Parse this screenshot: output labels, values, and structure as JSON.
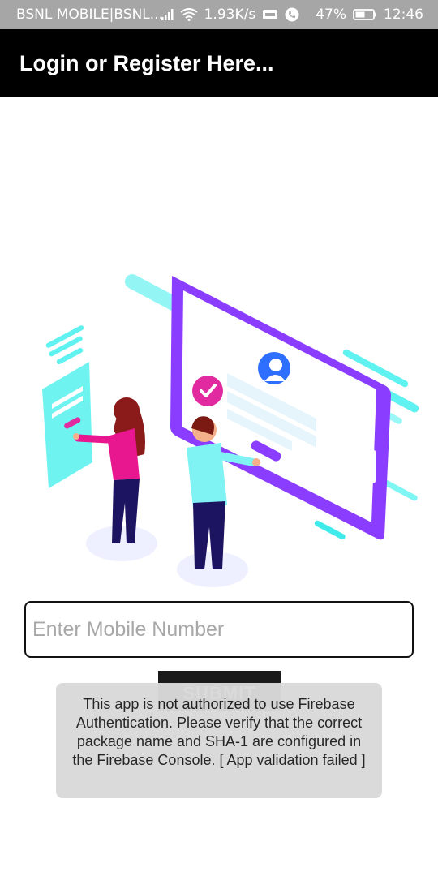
{
  "status_bar": {
    "carrier": "BSNL MOBILE|BSNL...",
    "net_speed": "1.93K/s",
    "battery": "47%",
    "time": "12:46",
    "icons": [
      "signal-icon",
      "wifi-icon",
      "volte-icon",
      "call-icon",
      "battery-icon"
    ]
  },
  "app_bar": {
    "title": "Login or Register Here..."
  },
  "form": {
    "mobile_placeholder": "Enter Mobile Number",
    "mobile_value": "",
    "submit_label": "SUBMIT"
  },
  "toast": {
    "message": "This app is not authorized to use Firebase Authentication. Please verify that the correct package name and SHA-1 are configured in the Firebase Console. [ App validation failed ]"
  },
  "colors": {
    "status_bar_bg": "#a6a6a6",
    "app_bar_bg": "#000000",
    "accent_purple": "#8b3dff",
    "accent_cyan": "#5ff2f0",
    "accent_pink": "#e22aa0",
    "toast_bg": "#d9d9d9"
  }
}
